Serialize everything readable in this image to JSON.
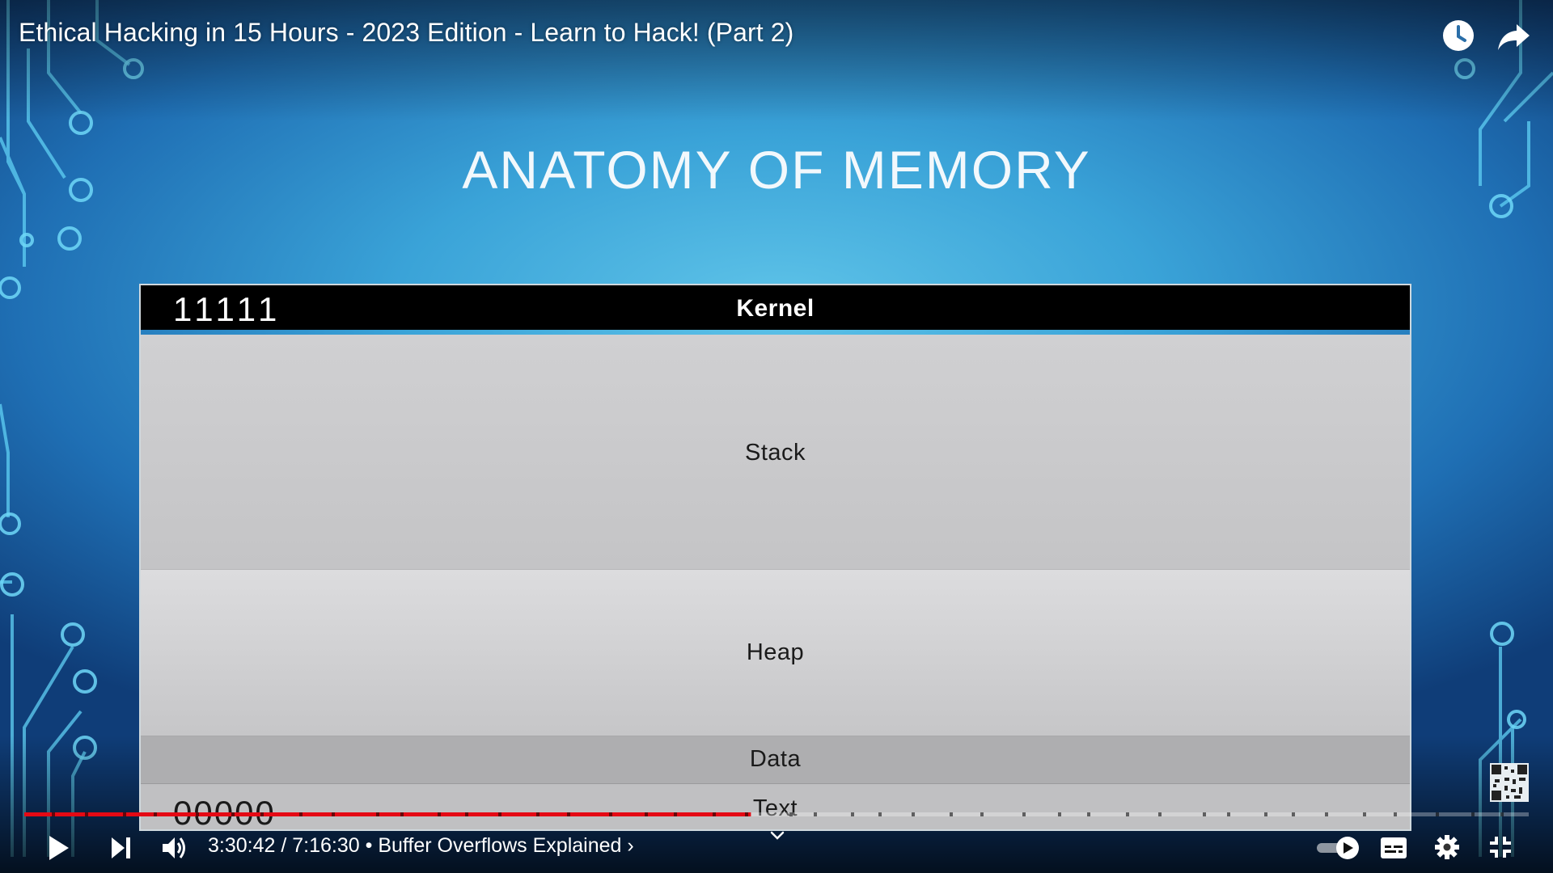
{
  "video": {
    "title": "Ethical Hacking in 15 Hours - 2023 Edition - Learn to Hack! (Part 2)"
  },
  "slide": {
    "title": "ANATOMY OF MEMORY",
    "address_high": "11111",
    "address_low": "00000",
    "segments": {
      "kernel": "Kernel",
      "stack": "Stack",
      "heap": "Heap",
      "data": "Data",
      "text": "Text"
    }
  },
  "player": {
    "current_time": "3:30:42",
    "duration": "7:16:30",
    "time_separator": " / ",
    "chapter": "• Buffer Overflows Explained",
    "chapter_chevron": "›",
    "progress_fraction": 0.483,
    "autoplay_on": true,
    "accent_color": "#e50914",
    "icons": [
      "watch-later-icon",
      "share-icon",
      "play-icon",
      "next-icon",
      "volume-icon",
      "chevron-down-icon",
      "autoplay-toggle-icon",
      "subtitles-icon",
      "settings-icon",
      "exit-fullscreen-icon"
    ]
  }
}
